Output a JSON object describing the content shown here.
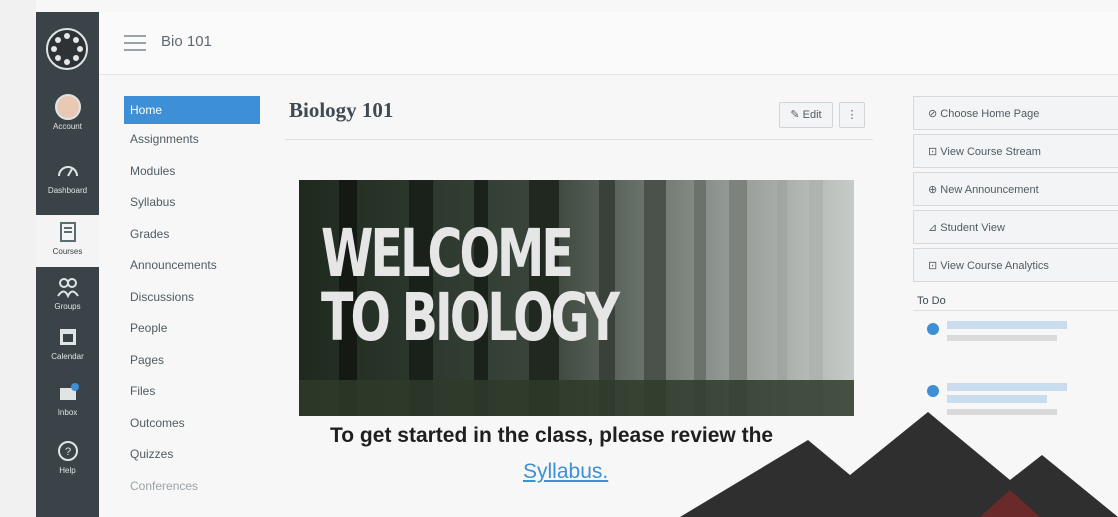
{
  "global_nav": {
    "items": [
      {
        "key": "account",
        "label": "Account",
        "icon": "avatar-icon"
      },
      {
        "key": "dashboard",
        "label": "Dashboard",
        "icon": "speedometer-icon"
      },
      {
        "key": "courses",
        "label": "Courses",
        "icon": "book-icon"
      },
      {
        "key": "groups",
        "label": "Groups",
        "icon": "groups-icon"
      },
      {
        "key": "calendar",
        "label": "Calendar",
        "icon": "calendar-icon"
      },
      {
        "key": "inbox",
        "label": "Inbox",
        "icon": "inbox-icon"
      },
      {
        "key": "help",
        "label": "Help",
        "icon": "help-icon"
      }
    ]
  },
  "header": {
    "breadcrumb": "Bio 101"
  },
  "course_nav": {
    "items": [
      "Home",
      "Assignments",
      "Modules",
      "Syllabus",
      "Grades",
      "Announcements",
      "Discussions",
      "People",
      "Pages",
      "Files",
      "Outcomes",
      "Quizzes",
      "Conferences"
    ]
  },
  "page": {
    "title": "Biology 101",
    "edit_label": "✎ Edit",
    "more_label": "⋮",
    "banner_line1": "WELCOME",
    "banner_line2": "TO BIOLOGY",
    "intro": "To get started in the class, please review the",
    "link": "Syllabus."
  },
  "sidebar": {
    "buttons": [
      "⊘ Choose Home Page",
      "⊡ View Course Stream",
      "⊕ New Announcement",
      "⊿ Student View",
      "⊡ View Course Analytics"
    ],
    "todo_title": "To Do"
  },
  "colors": {
    "accent": "#3d8fd6",
    "nav_bg": "#3a4348"
  }
}
